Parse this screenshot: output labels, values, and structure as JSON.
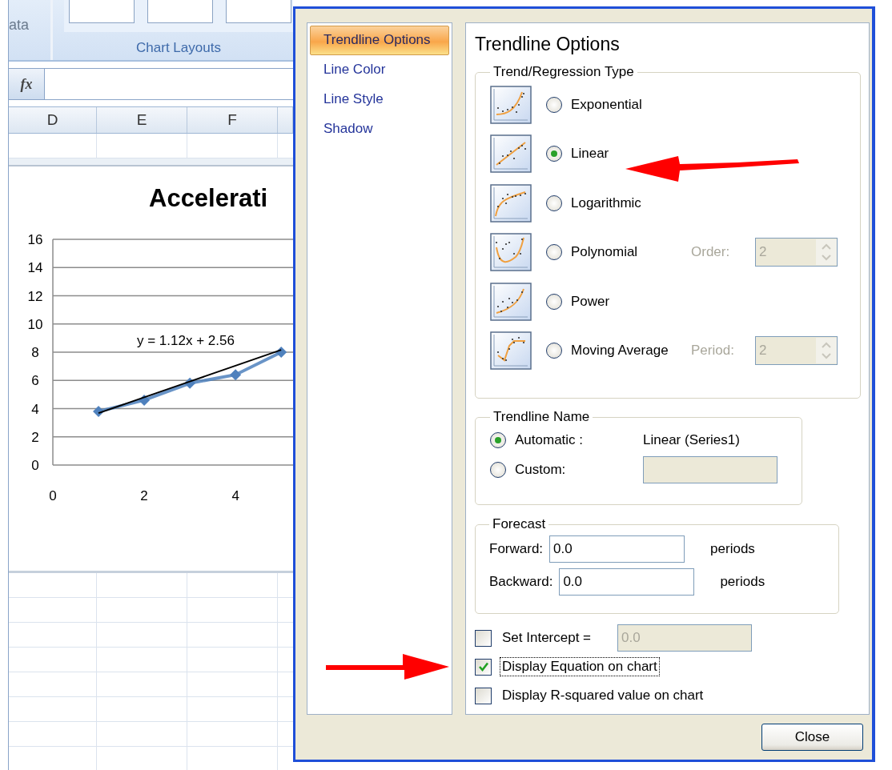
{
  "excel": {
    "ribbon": {
      "partial_label": "ata",
      "group_label": "Chart Layouts"
    },
    "formula_bar": {
      "function_button": "fx"
    },
    "columns": [
      "D",
      "E",
      "F"
    ],
    "chart": {
      "title": "Accelerati",
      "equation": "y = 1.12x + 2.56",
      "chart_data": {
        "type": "line",
        "grid": true,
        "x": [
          1,
          2,
          3,
          4,
          5
        ],
        "xlim": [
          0,
          5.26
        ],
        "ylim": [
          0,
          16
        ],
        "xticks": [
          0,
          2,
          4
        ],
        "yticks": [
          0,
          2,
          4,
          6,
          8,
          10,
          12,
          14,
          16
        ],
        "series": [
          {
            "color": "#4f81bd",
            "marker": "diamond",
            "values": [
              3.8,
              4.6,
              5.8,
              6.4,
              8.0
            ]
          },
          {
            "color": "#000000",
            "values": [
              3.68,
              4.8,
              5.92,
              7.04,
              8.16
            ]
          }
        ]
      }
    }
  },
  "dialog": {
    "nav": [
      {
        "label": "Trendline Options",
        "selected": true
      },
      {
        "label": "Line Color",
        "selected": false
      },
      {
        "label": "Line Style",
        "selected": false
      },
      {
        "label": "Shadow",
        "selected": false
      }
    ],
    "heading": "Trendline Options",
    "trend_type": {
      "title": "Trend/Regression Type",
      "types": [
        {
          "kind": "exponential",
          "label": "Exponential",
          "selected": false
        },
        {
          "kind": "linear",
          "label": "Linear",
          "selected": true
        },
        {
          "kind": "logarithmic",
          "label": "Logarithmic",
          "selected": false
        },
        {
          "kind": "polynomial",
          "label": "Polynomial",
          "selected": false,
          "option": {
            "label": "Order:",
            "value": "2",
            "disabled": true
          }
        },
        {
          "kind": "power",
          "label": "Power",
          "selected": false
        },
        {
          "kind": "moving-average",
          "label": "Moving Average",
          "selected": false,
          "option": {
            "label": "Period:",
            "value": "2",
            "disabled": true
          }
        }
      ]
    },
    "trendline_name": {
      "title": "Trendline Name",
      "automatic": {
        "label": "Automatic :",
        "selected": true,
        "value": "Linear (Series1)"
      },
      "custom": {
        "label": "Custom:",
        "selected": false,
        "field": {
          "disabled": true
        }
      }
    },
    "forecast": {
      "title": "Forecast",
      "rows": [
        {
          "label": "Forward:",
          "value": "0.0",
          "unit": "periods"
        },
        {
          "label": "Backward:",
          "value": "0.0",
          "unit": "periods"
        }
      ]
    },
    "checks": [
      {
        "label": "Set Intercept =",
        "checked": false,
        "focused": false,
        "field": {
          "value": "0.0",
          "disabled": true
        }
      },
      {
        "label": "Display Equation on chart",
        "checked": true,
        "focused": true
      },
      {
        "label": "Display R-squared value on chart",
        "checked": false,
        "focused": false
      }
    ],
    "close_button": "Close"
  }
}
